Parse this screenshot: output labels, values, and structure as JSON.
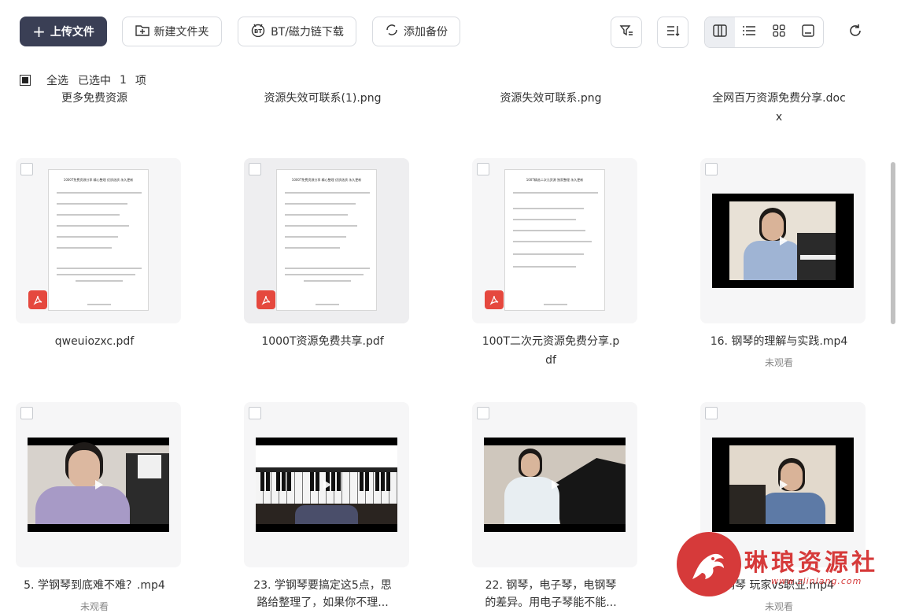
{
  "toolbar": {
    "upload": "上传文件",
    "new_folder": "新建文件夹",
    "bt": "BT/磁力链下载",
    "backup": "添加备份"
  },
  "selection": {
    "select_all": "全选",
    "selected": "已选中",
    "count": "1",
    "unit": "项"
  },
  "top_row_names": [
    "更多免费资源",
    "资源失效可联系(1).png",
    "资源失效可联系.png",
    "全网百万资源免费分享.doc",
    "x"
  ],
  "files": [
    {
      "name": "qweuiozxc.pdf",
      "kind": "pdf",
      "doc_title": "1000T免费资源分享 精心整理 优质选质 永久更新"
    },
    {
      "name": "1000T资源免费共享.pdf",
      "kind": "pdf",
      "doc_title": "1000T免费资源分享 精心整理 优质选质 永久更新"
    },
    {
      "name1": "100T二次元资源免费分享.p",
      "name2": "df",
      "kind": "pdf",
      "doc_title": "100T精选二次元资源 独家整理 永久更新"
    },
    {
      "name": "16. 钢琴的理解与实践.mp4",
      "status": "未观看",
      "kind": "video"
    },
    {
      "name": "5. 学钢琴到底难不难？.mp4",
      "status": "未观看",
      "kind": "video"
    },
    {
      "name1": "23. 学钢琴要搞定这5点，思",
      "name2": "路给整理了，如果你不理...",
      "kind": "video"
    },
    {
      "name1": "22. 钢琴，电子琴，电钢琴",
      "name2": "的差异。用电子琴能不能...",
      "kind": "video"
    },
    {
      "name": "钢琴 玩家vs职业.mp4",
      "status": "未观看",
      "kind": "video"
    }
  ],
  "watermark": {
    "text": "琳琅资源社",
    "url": "www.zlinlang.com"
  },
  "colors": {
    "primary": "#3a3f55",
    "pdf": "#e5483e",
    "watermark": "#d63a3a"
  }
}
